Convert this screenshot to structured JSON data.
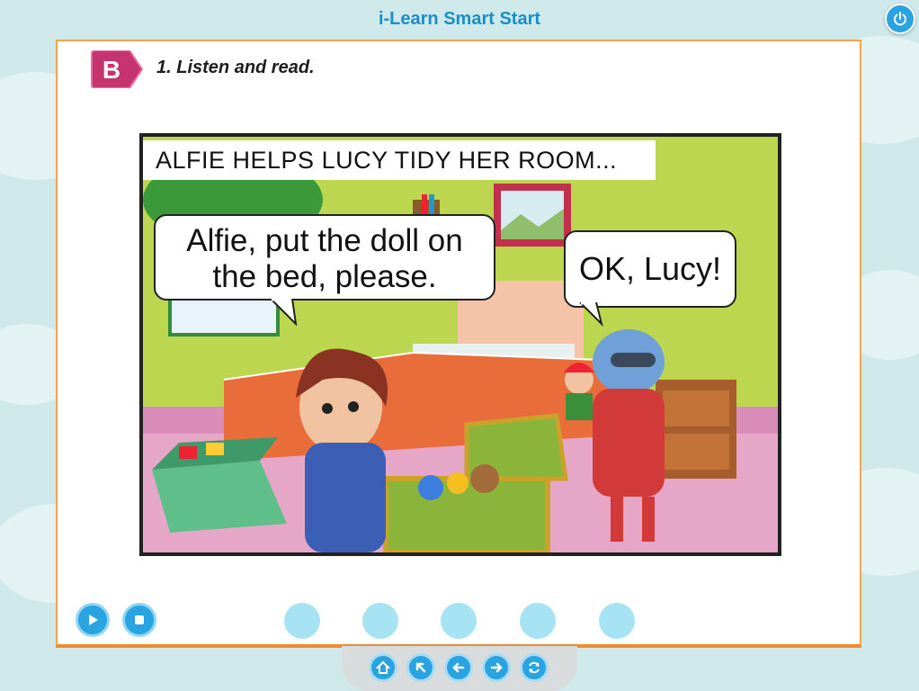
{
  "app": {
    "title": "i-Learn Smart Start"
  },
  "exercise": {
    "badge": "B",
    "instruction": "1. Listen and read."
  },
  "comic": {
    "caption": "ALFIE HELPS LUCY TIDY HER ROOM...",
    "bubble_1": {
      "line_1": "Alfie, put the doll on",
      "line_2": "the bed, please."
    },
    "bubble_2": "OK, Lucy!"
  },
  "controls": {
    "play_icon": "play-icon",
    "stop_icon": "stop-icon",
    "dots": 5
  },
  "nav": {
    "icons": [
      "home-icon",
      "back-arrow-icon",
      "previous-icon",
      "next-icon",
      "refresh-icon"
    ]
  },
  "colors": {
    "accent": "#2aa4e0",
    "panel_border": "#f3a453",
    "badge": "#c5346f"
  }
}
